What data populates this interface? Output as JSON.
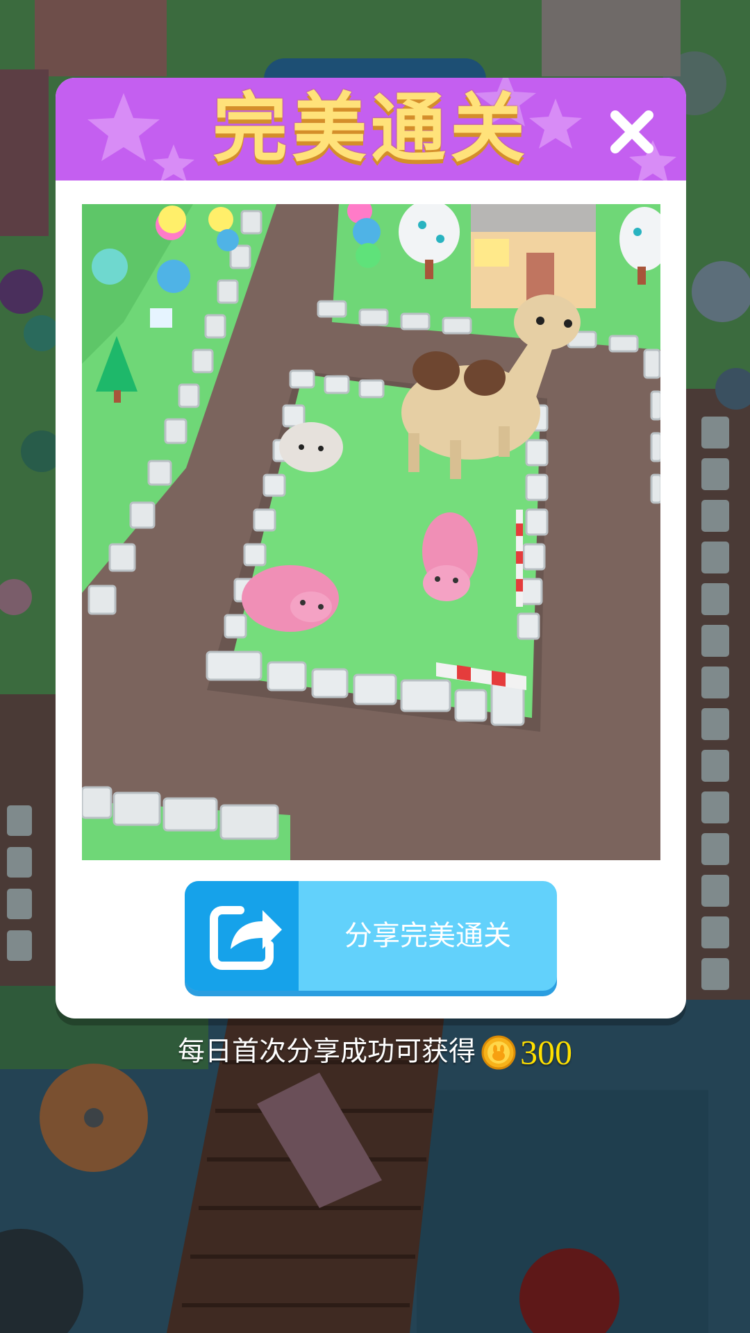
{
  "modal": {
    "title": "完美通关",
    "close_icon": "close-icon",
    "scene_description_icon": "zoo-enclosure-screenshot"
  },
  "share_button": {
    "label": "分享完美通关",
    "icon": "share-icon"
  },
  "reward": {
    "text": "每日首次分享成功可获得",
    "coin_icon": "coin-icon",
    "amount": "300"
  },
  "colors": {
    "header_purple": "#c45ff0",
    "title_yellow": "#ffe27a",
    "share_light_blue": "#62d1fb",
    "share_dark_blue": "#16a2ea",
    "reward_amount_yellow": "#ffe000"
  }
}
